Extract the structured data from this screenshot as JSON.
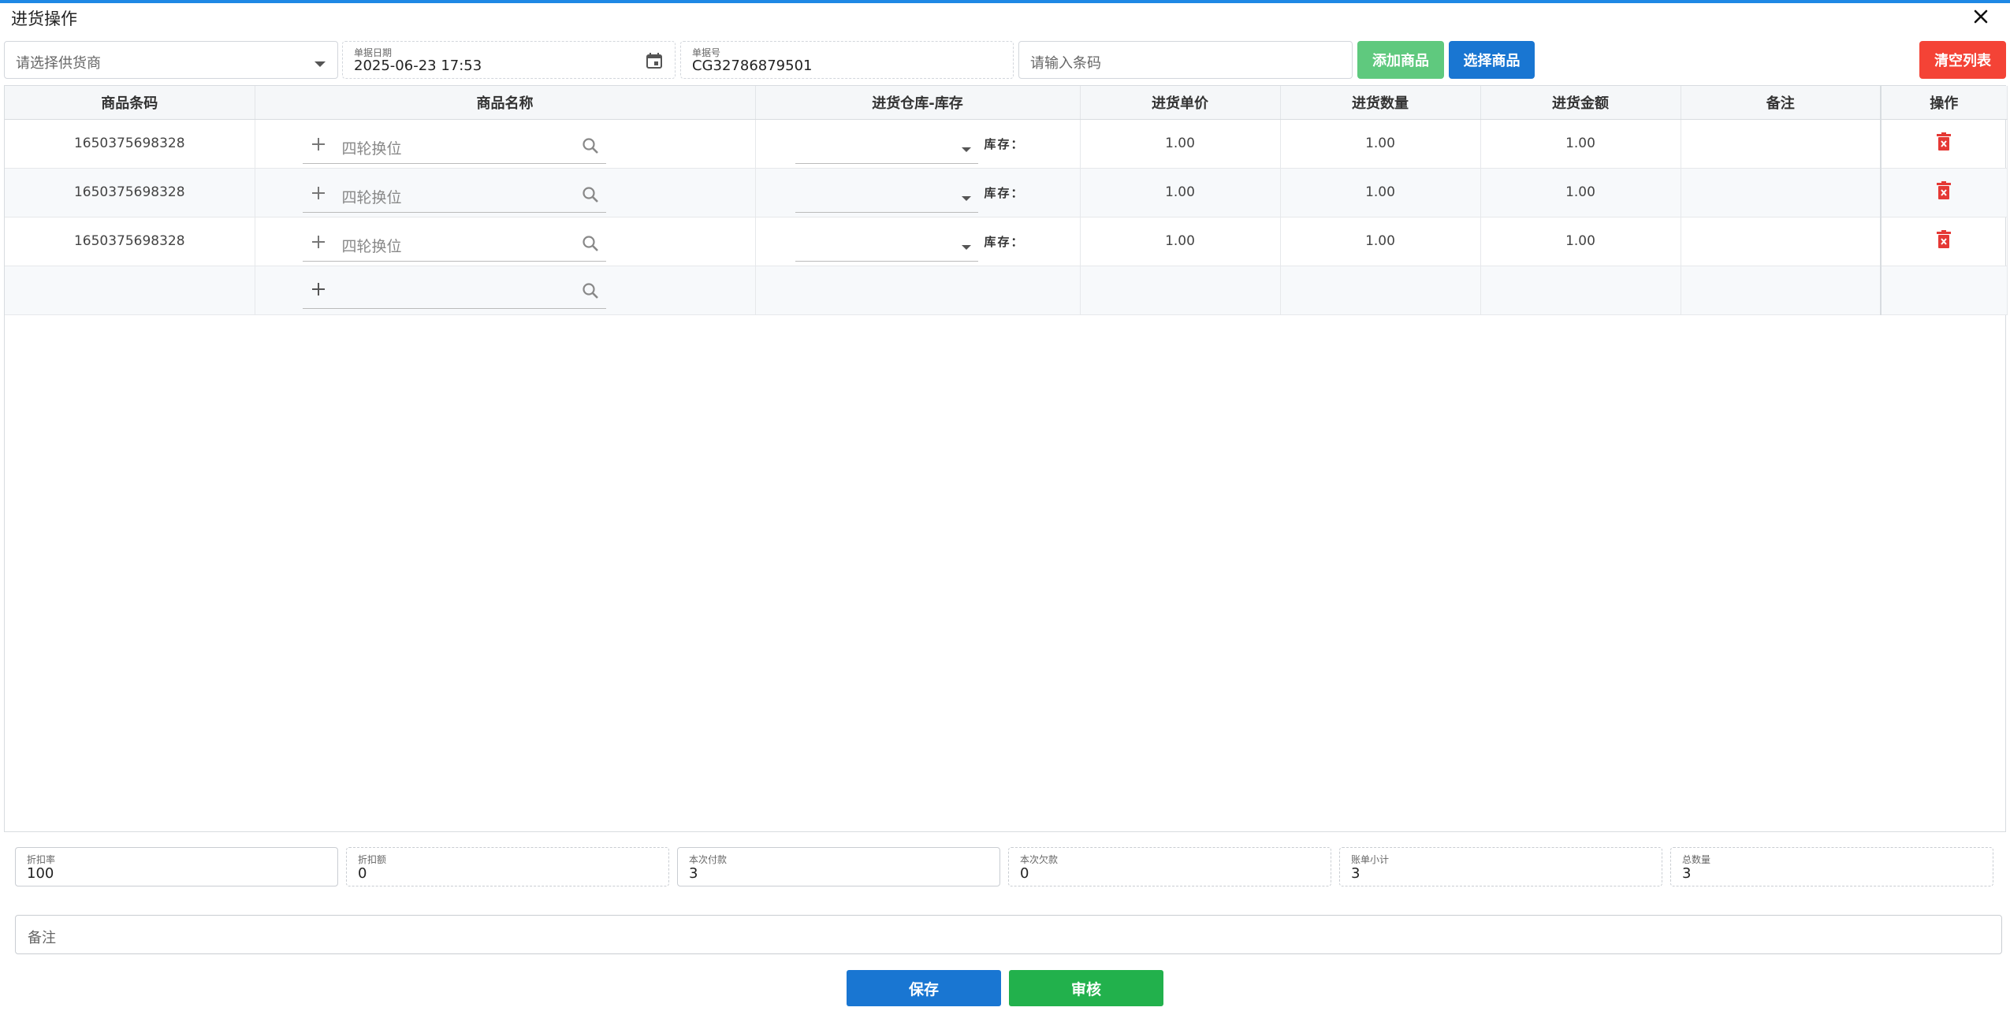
{
  "dialog": {
    "title": "进货操作"
  },
  "toolbar": {
    "supplier_placeholder": "请选择供货商",
    "date_label": "单据日期",
    "date_value": "2025-06-23 17:53",
    "doc_label": "单据号",
    "doc_value": "CG32786879501",
    "barcode_placeholder": "请输入条码",
    "add_product": "添加商品",
    "select_product": "选择商品",
    "clear_list": "清空列表"
  },
  "colors": {
    "green": "#5fc97e",
    "blue": "#1976d2",
    "red": "#f44336",
    "save": "#1976d2",
    "audit": "#22b14c",
    "topline": "#1e88e5"
  },
  "table": {
    "headers": [
      "商品条码",
      "商品名称",
      "进货仓库-库存",
      "进货单价",
      "进货数量",
      "进货金额",
      "备注",
      "操作"
    ],
    "stock_label": "库存：",
    "rows": [
      {
        "barcode": "1650375698328",
        "name": "四轮换位",
        "price": "1.00",
        "qty": "1.00",
        "amount": "1.00"
      },
      {
        "barcode": "1650375698328",
        "name": "四轮换位",
        "price": "1.00",
        "qty": "1.00",
        "amount": "1.00"
      },
      {
        "barcode": "1650375698328",
        "name": "四轮换位",
        "price": "1.00",
        "qty": "1.00",
        "amount": "1.00"
      }
    ]
  },
  "summary": {
    "discount_rate_label": "折扣率",
    "discount_rate": "100",
    "discount_amount_label": "折扣额",
    "discount_amount": "0",
    "paid_label": "本次付款",
    "paid": "3",
    "owed_label": "本次欠款",
    "owed": "0",
    "subtotal_label": "账单小计",
    "subtotal": "3",
    "total_qty_label": "总数量",
    "total_qty": "3"
  },
  "remark_placeholder": "备注",
  "actions": {
    "save": "保存",
    "audit": "审核"
  }
}
